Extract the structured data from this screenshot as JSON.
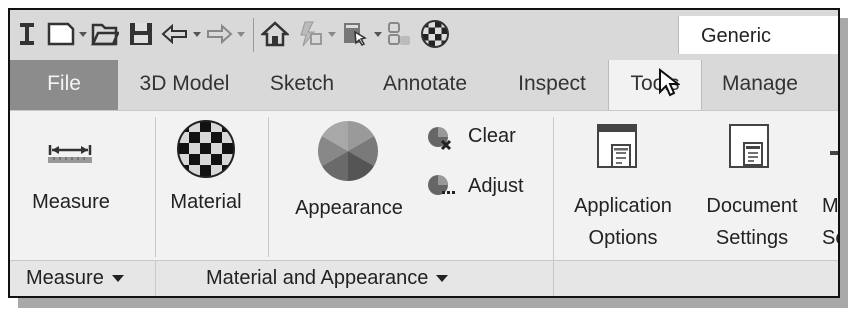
{
  "quick_access": {
    "icons": [
      "text-cursor-icon",
      "new-file-icon",
      "open-folder-icon",
      "save-icon",
      "undo-icon",
      "redo-icon",
      "home-icon",
      "update-icon",
      "select-icon",
      "ipart-icon",
      "color-sphere-icon"
    ],
    "style_value": "Generic"
  },
  "tabs": [
    {
      "label": "File"
    },
    {
      "label": "3D Model"
    },
    {
      "label": "Sketch"
    },
    {
      "label": "Annotate"
    },
    {
      "label": "Inspect"
    },
    {
      "label": "Tools"
    },
    {
      "label": "Manage"
    }
  ],
  "active_tab": "Tools",
  "ribbon": {
    "measure": {
      "label": "Measure"
    },
    "material": {
      "label": "Material"
    },
    "appearance": {
      "label": "Appearance"
    },
    "clear": {
      "label": "Clear"
    },
    "adjust": {
      "label": "Adjust"
    },
    "app_options": {
      "line1": "Application",
      "line2": "Options"
    },
    "doc_settings": {
      "line1": "Document",
      "line2": "Settings"
    },
    "migrate": {
      "line1": "Mi",
      "line2": "Se"
    }
  },
  "panels": {
    "measure": "Measure",
    "material_appearance": "Material and Appearance"
  },
  "colors": {
    "toolbar": "#d9d9d9",
    "file_tab": "#8c8c8c",
    "ribbon": "#f2f2f2",
    "panel_bar": "#e6e6e6"
  }
}
